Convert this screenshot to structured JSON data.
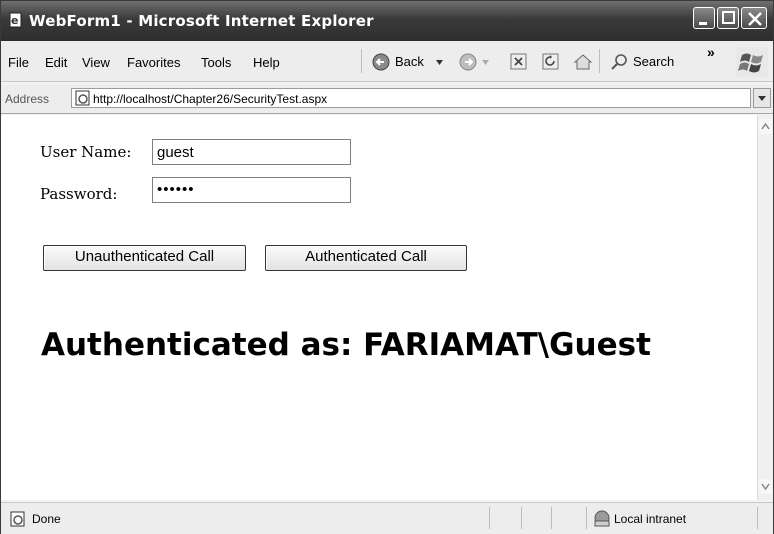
{
  "window": {
    "title": "WebForm1 - Microsoft Internet Explorer"
  },
  "menu": {
    "file": "File",
    "edit": "Edit",
    "view": "View",
    "favorites": "Favorites",
    "tools": "Tools",
    "help": "Help"
  },
  "toolbar": {
    "back_label": "Back",
    "search_label": "Search",
    "more_glyph": "»"
  },
  "address": {
    "label": "Address",
    "url": "http://localhost/Chapter26/SecurityTest.aspx"
  },
  "form": {
    "username_label": "User Name:",
    "username_value": "guest",
    "password_label": "Password:",
    "password_value": "••••••",
    "unauth_button": "Unauthenticated Call",
    "auth_button": "Authenticated Call",
    "result_text": "Authenticated as: FARIAMAT\\Guest"
  },
  "status": {
    "text": "Done",
    "zone": "Local intranet"
  },
  "icons": [
    "ie-page-icon",
    "minimize-icon",
    "maximize-icon",
    "close-icon",
    "back-arrow-icon",
    "forward-arrow-icon",
    "stop-icon",
    "refresh-icon",
    "home-icon",
    "search-icon",
    "windows-flag-icon",
    "dropdown-arrow-icon",
    "scroll-up-icon",
    "scroll-down-icon",
    "intranet-icon"
  ]
}
